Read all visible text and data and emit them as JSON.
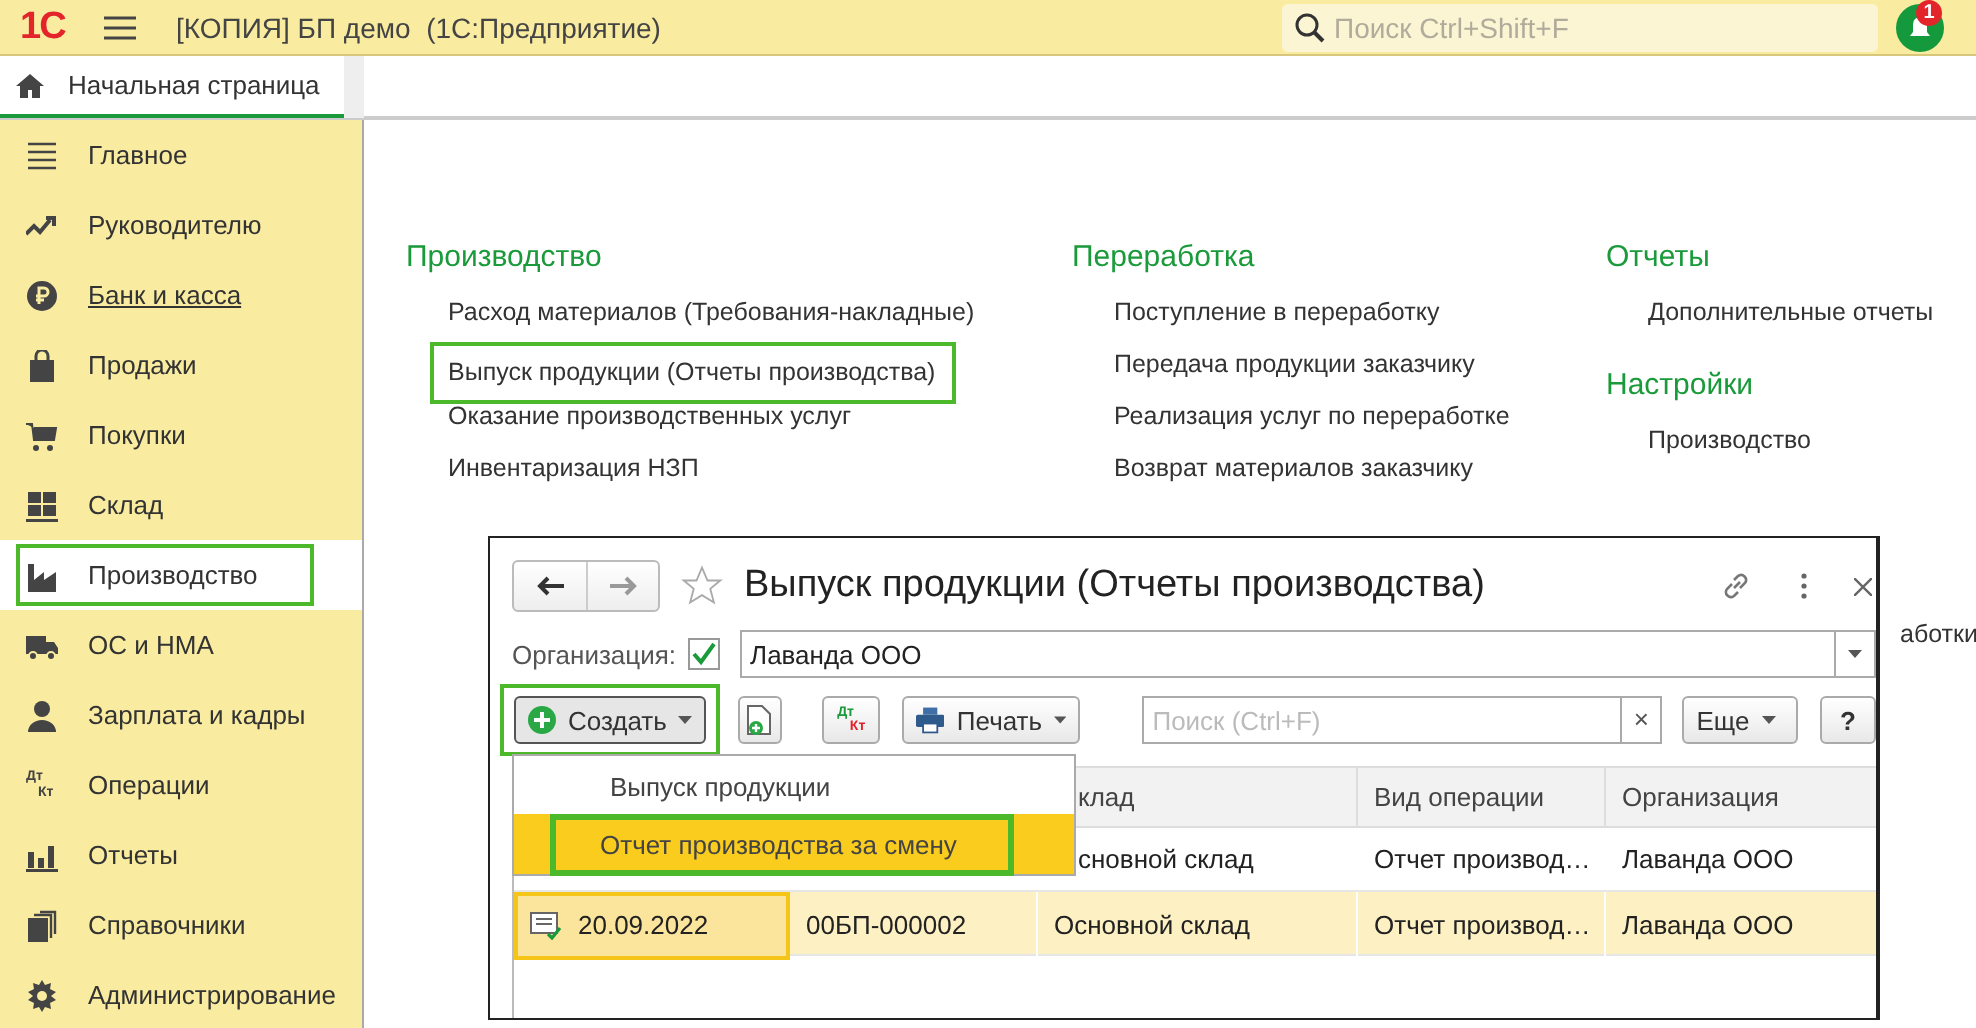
{
  "app_bar": {
    "logo": "1С",
    "title": "[КОПИЯ] БП демо  (1С:Предприятие)",
    "search": {
      "placeholder": "Поиск Ctrl+Shift+F"
    },
    "notifications": "1"
  },
  "home_tab": {
    "label": "Начальная страница",
    "selected": true
  },
  "sidebar": {
    "items": [
      {
        "label": "Главное",
        "kind": "menu",
        "selected": false,
        "hover": false,
        "highlighted": false
      },
      {
        "label": "Руководителю",
        "kind": "trend",
        "selected": false,
        "hover": false,
        "highlighted": false
      },
      {
        "label": "Банк и касса",
        "kind": "ruble",
        "selected": false,
        "hover": true,
        "highlighted": false
      },
      {
        "label": "Продажи",
        "kind": "bag",
        "selected": false,
        "hover": false,
        "highlighted": false
      },
      {
        "label": "Покупки",
        "kind": "cart",
        "selected": false,
        "hover": false,
        "highlighted": false
      },
      {
        "label": "Склад",
        "kind": "grid",
        "selected": false,
        "hover": false,
        "highlighted": false
      },
      {
        "label": "Производство",
        "kind": "factory",
        "selected": true,
        "hover": false,
        "highlighted": true
      },
      {
        "label": "ОС и НМА",
        "kind": "truck",
        "selected": false,
        "hover": false,
        "highlighted": false
      },
      {
        "label": "Зарплата и кадры",
        "kind": "person",
        "selected": false,
        "hover": false,
        "highlighted": false
      },
      {
        "label": "Операции",
        "kind": "dtkt",
        "icon_text": [
          "Дт",
          "Кт"
        ],
        "selected": false,
        "hover": false,
        "highlighted": false
      },
      {
        "label": "Отчеты",
        "kind": "bars",
        "selected": false,
        "hover": false,
        "highlighted": false
      },
      {
        "label": "Справочники",
        "kind": "books",
        "selected": false,
        "hover": false,
        "highlighted": false
      },
      {
        "label": "Администрирование",
        "kind": "gear",
        "selected": false,
        "hover": false,
        "highlighted": false
      }
    ]
  },
  "columns": [
    {
      "groups": [
        {
          "heading": "Производство",
          "links": [
            {
              "label": "Расход материалов (Требования-накладные)",
              "highlighted": false
            },
            {
              "label": "Выпуск продукции (Отчеты производства)",
              "highlighted": true
            },
            {
              "label": "Оказание производственных услуг",
              "highlighted": false
            },
            {
              "label": "Инвентаризация НЗП",
              "highlighted": false
            }
          ]
        }
      ]
    },
    {
      "groups": [
        {
          "heading": "Переработка",
          "links": [
            {
              "label": "Поступление в переработку",
              "highlighted": false
            },
            {
              "label": "Передача продукции заказчику",
              "highlighted": false
            },
            {
              "label": "Реализация услуг по переработке",
              "highlighted": false
            },
            {
              "label": "Возврат материалов заказчику",
              "highlighted": false
            }
          ]
        }
      ]
    },
    {
      "groups": [
        {
          "heading": "Отчеты",
          "links": [
            {
              "label": "Дополнительные отчеты",
              "highlighted": false
            }
          ]
        },
        {
          "heading": "Настройки",
          "links": [
            {
              "label": "Производство",
              "highlighted": false
            }
          ]
        }
      ]
    }
  ],
  "partial_text": "аботки",
  "document_window": {
    "title": "Выпуск продукции (Отчеты производства)",
    "favorite": false,
    "organization": {
      "label": "Организация:",
      "checked": true,
      "value": "Лаванда ООО"
    },
    "toolbar": {
      "create": {
        "label": "Создать",
        "highlighted": true
      },
      "dtkt": [
        "Дт",
        "Кт"
      ],
      "print": "Печать",
      "search": {
        "placeholder": "Поиск (Ctrl+F)",
        "clear": "×"
      },
      "more": "Еще",
      "help": "?"
    },
    "create_menu": [
      {
        "label": "Выпуск продукции",
        "selected": false,
        "highlighted": false
      },
      {
        "label": "Отчет производства за смену",
        "selected": true,
        "highlighted": true
      }
    ],
    "table": {
      "columns": [
        "клад",
        "Вид операции",
        "Организация"
      ],
      "rows": [
        {
          "warehouse": "сновной склад",
          "operation": "Отчет производ…",
          "organization": "Лаванда ООО",
          "selected": false
        },
        {
          "date": "20.09.2022",
          "number": "00БП-000002",
          "warehouse": "Основной склад",
          "operation": "Отчет производ…",
          "organization": "Лаванда ООО",
          "selected": true
        }
      ]
    }
  }
}
